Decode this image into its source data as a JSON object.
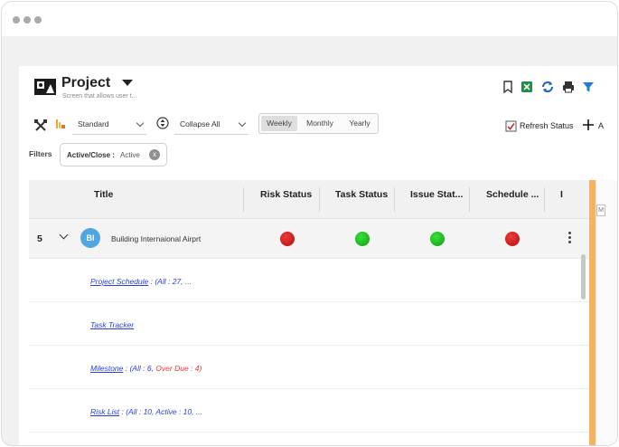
{
  "project": {
    "title": "Project",
    "subtitle": "Screen that allows user t..."
  },
  "toolbar": {
    "view_select": "Standard",
    "collapse_select": "Collapse All",
    "periods": [
      {
        "label": "Weekly",
        "active": true
      },
      {
        "label": "Monthly",
        "active": false
      },
      {
        "label": "Yearly",
        "active": false
      }
    ],
    "refresh_label": "Refresh Status",
    "add_label": "A"
  },
  "filters": {
    "label": "Filters",
    "chip_key": "Active/Close :",
    "chip_value": "Active",
    "chip_close": "x"
  },
  "grid": {
    "columns": [
      "Title",
      "Risk Status",
      "Task Status",
      "Issue Stat...",
      "Schedule ...",
      "I"
    ],
    "row": {
      "number": "5",
      "avatar": "BI",
      "title": "Building Internaional Airprt",
      "statuses": [
        "red",
        "green",
        "green",
        "red"
      ]
    },
    "sub_rows": [
      {
        "link": "Project Schedule",
        "meta": " : (All : 27,     ...",
        "over": ""
      },
      {
        "link": "Task Tracker",
        "meta": "",
        "over": ""
      },
      {
        "link": "Milestone",
        "meta": " : (All : 6,     ",
        "over": "Over Due : 4)"
      },
      {
        "link": "Risk List",
        "meta": " : (All : 10,     Active : 10,     ...",
        "over": ""
      }
    ]
  },
  "side_panel": {
    "box_label": "M"
  },
  "colors": {
    "status_red": "#d11a1a",
    "status_green": "#1fc323",
    "avatar": "#4ea7e0",
    "link": "#2a3fd6",
    "overdue": "#e23b3b",
    "accent_bar": "#f7b25f"
  }
}
